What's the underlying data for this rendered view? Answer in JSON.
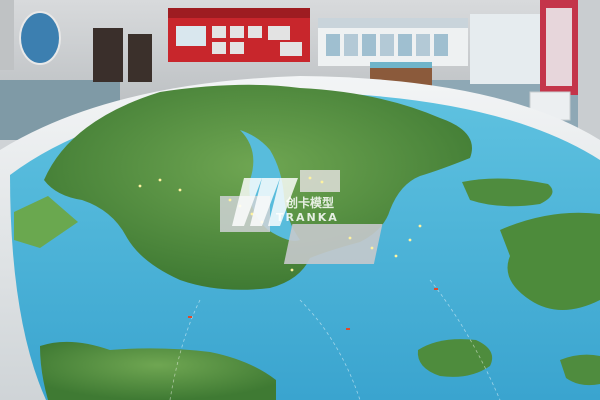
{
  "watermark": {
    "brand_latin": "TRANKA",
    "brand_chinese": "创卡模型"
  },
  "colors": {
    "water": "#46b3d8",
    "land": "#4a8a3c",
    "exhibit_red": "#c8262c",
    "rim": "#e9ecee"
  },
  "icons": [
    "watermark-logo-icon"
  ]
}
